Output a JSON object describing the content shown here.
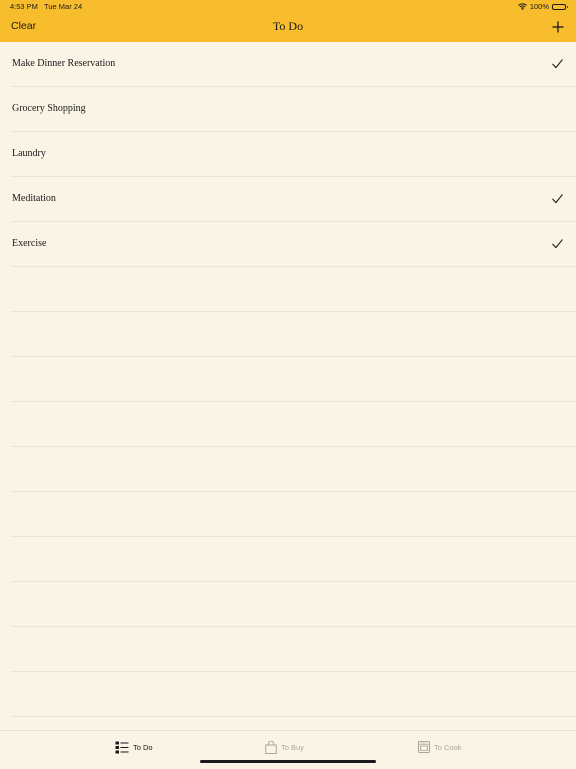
{
  "status_bar": {
    "time_date": "4:53 PM   Tue Mar 24",
    "battery_percent": "100%",
    "battery_level": 1.0,
    "icons": [
      "wifi-icon",
      "battery-icon"
    ]
  },
  "nav": {
    "clear_label": "Clear",
    "title": "To Do",
    "add_icon": "plus-icon"
  },
  "todos": [
    {
      "label": "Make Dinner Reservation",
      "checked": true
    },
    {
      "label": "Grocery Shopping",
      "checked": false
    },
    {
      "label": "Laundry",
      "checked": false
    },
    {
      "label": "Meditation",
      "checked": true
    },
    {
      "label": "Exercise",
      "checked": true
    }
  ],
  "tabs": [
    {
      "label": "To Do",
      "icon": "list-icon",
      "selected": true
    },
    {
      "label": "To Buy",
      "icon": "shopping-bag-icon",
      "selected": false
    },
    {
      "label": "To Cook",
      "icon": "oven-icon",
      "selected": false
    }
  ],
  "colors": {
    "accent": "#f7bd2c",
    "background": "#faf4e6",
    "separator": "#ebe5d6",
    "tab_inactive": "#a9a59a"
  }
}
